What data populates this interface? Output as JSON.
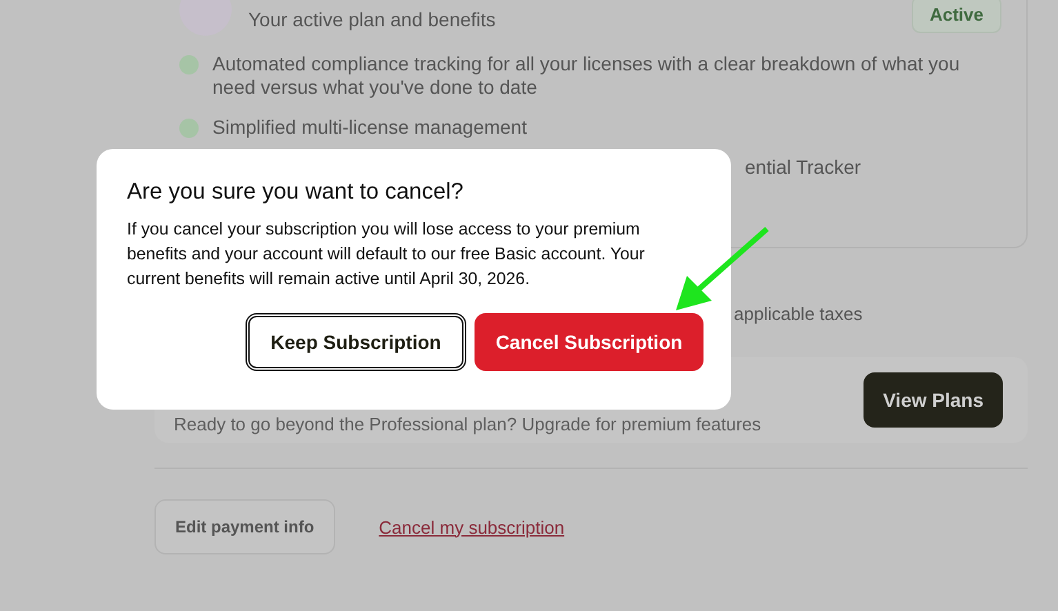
{
  "page": {
    "plan_card": {
      "subtitle": "Your active plan and benefits",
      "badge": "Active",
      "features": [
        "Automated compliance tracking for all your licenses with a clear breakdown of what you need versus what you've done to date",
        "Simplified multi-license management"
      ],
      "feature_fragment": "ential Tracker"
    },
    "price_note_fragment": "applicable taxes",
    "upgrade": {
      "text": "Ready to go beyond the Professional plan? Upgrade for premium features",
      "button": "View Plans"
    },
    "actions": {
      "edit_button": "Edit payment info",
      "cancel_link": "Cancel my subscription"
    }
  },
  "dialog": {
    "title": "Are you sure you want to cancel?",
    "body": "If you cancel your subscription you will lose access to your premium benefits and your account will default to our free Basic account. Your current benefits will remain active until April 30, 2026.",
    "buttons": [
      {
        "label": "Keep Subscription",
        "kind": "secondary"
      },
      {
        "label": "Cancel Subscription",
        "kind": "danger"
      }
    ]
  }
}
